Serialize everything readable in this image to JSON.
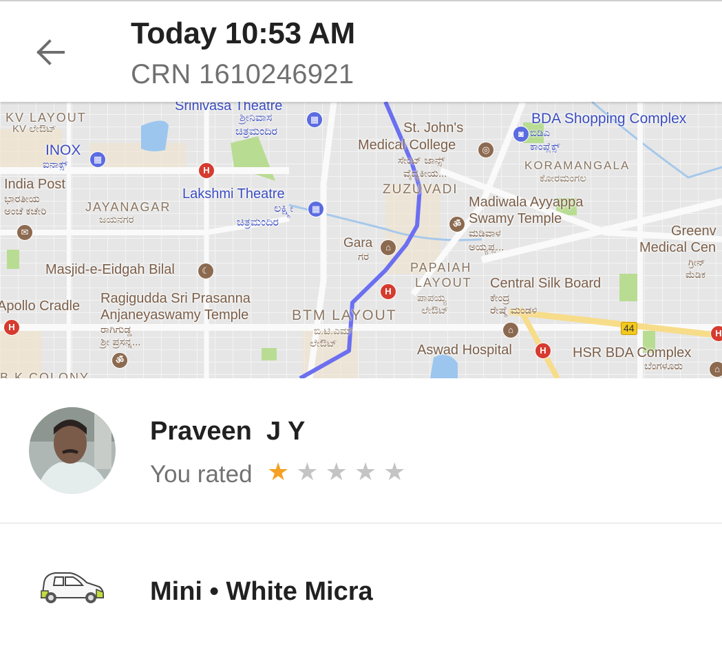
{
  "header": {
    "back_icon": "arrow-left-icon",
    "title": "Today 10:53 AM",
    "crn": "CRN 1610246921"
  },
  "map": {
    "route_color": "#6b6ff0",
    "highway_badge": "44",
    "labels": {
      "kv_layout": "KV LAYOUT",
      "kv_layout_kn": "KV ಲೇಔಟ್",
      "inox": "INOX",
      "inox_kn": "ಐನಾಕ್ಸ್",
      "india_post": "India Post",
      "india_post_kn1": "ಭಾರತೀಯ",
      "india_post_kn2": "ಅಂಚೆ ಕಚೇರಿ",
      "jayanagar": "JAYANAGAR",
      "jayanagar_kn": "ಜಯನಗರ",
      "srinivasa": "Srinivasa Theatre",
      "srinivasa_kn1": "ಶ್ರೀನಿವಾಸ",
      "srinivasa_kn2": "ಚಿತ್ರಮಂದಿರ",
      "lakshmi": "Lakshmi Theatre",
      "lakshmi_kn1": "ಲಕ್ಷ್ಮೀ",
      "lakshmi_kn2": "ಚಿತ್ರಮಂದಿರ",
      "stjohns1": "St. John's",
      "stjohns2": "Medical College",
      "stjohns_kn1": "ಸೇಂಟ್ ಜಾನ್ಸ್",
      "stjohns_kn2": "ವೈದ್ಯಕೀಯ...",
      "zuzuvadi": "ZUZUVADI",
      "bda_shopping": "BDA Shopping Complex",
      "bda_kn1": "ಬಿಡಿಎ",
      "bda_kn2": "ಕಾಂಪ್ಲೆಕ್ಸ್",
      "koramangala": "KORAMANGALA",
      "koramangala_kn": "ಕೋರಮಂಗಲ",
      "madiwala1": "Madiwala Ayyappa",
      "madiwala2": "Swamy Temple",
      "madiwala_kn1": "ಮಡಿವಾಳ",
      "madiwala_kn2": "ಅಯ್ಯಪ್ಪ...",
      "greenview1": "Greenv",
      "greenview2": "Medical Cen",
      "greenview_kn1": "ಗ್ರೀನ್",
      "greenview_kn2": "ಮೆಡಿಕ",
      "gara": "Gara",
      "gara_kn": "ಗರ",
      "masjid": "Masjid-e-Eidgah Bilal",
      "papaiah1": "PAPAIAH",
      "papaiah2": "LAYOUT",
      "papaiah_kn1": "ಪಾಪಯ್ಯ",
      "papaiah_kn2": "ಲೇಔಟ್",
      "silkboard": "Central Silk Board",
      "silkboard_kn1": "ಕೇಂದ್ರ",
      "silkboard_kn2": "ರೇಷ್ಮೆ ಮಂಡಳಿ",
      "apollo": "Apollo Cradle",
      "ragigudda1": "Ragigudda Sri Prasanna",
      "ragigudda2": "Anjaneyaswamy Temple",
      "ragigudda_kn1": "ರಾಗಿಗುಡ್ಡ",
      "ragigudda_kn2": "ಶ್ರೀ ಪ್ರಸನ್ನ...",
      "btm": "BTM LAYOUT",
      "btm_kn1": "ಬಿ.ಟಿ.ಎಮ್",
      "btm_kn2": "ಲೇಔಟ್",
      "aswad": "Aswad Hospital",
      "hsr": "HSR BDA Complex",
      "hsr_kn": "ಬೆಂಗಳೂರು",
      "bk_colony": "B K COLONY"
    }
  },
  "driver": {
    "name": "Praveen  J Y",
    "rated_label": "You rated",
    "rating": 1,
    "max_rating": 5,
    "star_filled_color": "#f4a124",
    "star_empty_color": "#c4c4c4"
  },
  "vehicle": {
    "icon": "car-icon",
    "description": "Mini • White Micra"
  }
}
